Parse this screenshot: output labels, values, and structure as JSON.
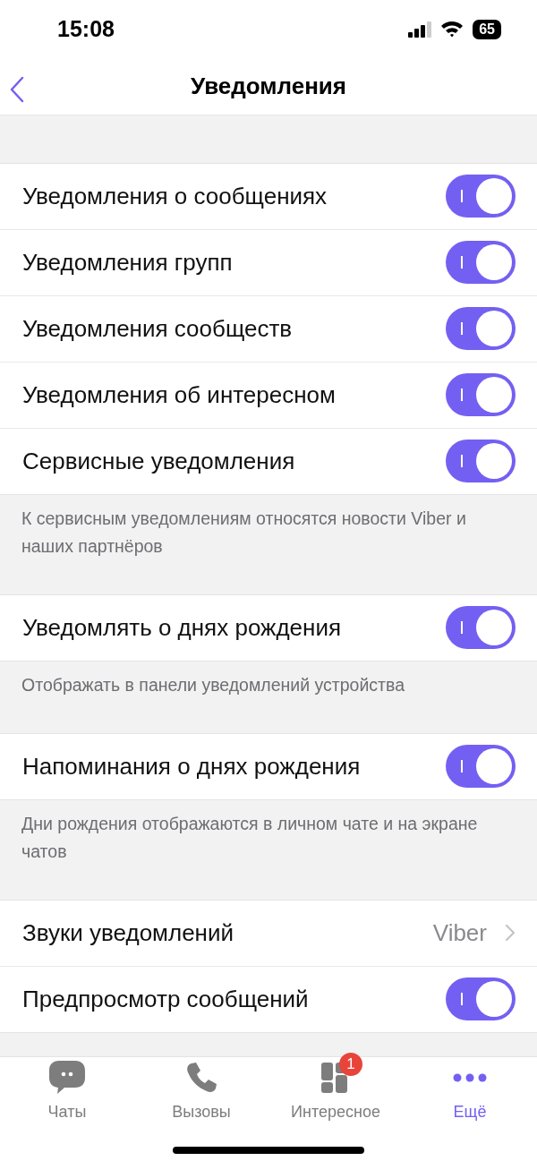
{
  "status_bar": {
    "time": "15:08",
    "battery": "65"
  },
  "nav": {
    "title": "Уведомления"
  },
  "sections": [
    {
      "rows": [
        {
          "kind": "toggle",
          "label": "Уведомления о сообщениях",
          "on": true
        },
        {
          "kind": "toggle",
          "label": "Уведомления групп",
          "on": true
        },
        {
          "kind": "toggle",
          "label": "Уведомления сообществ",
          "on": true
        },
        {
          "kind": "toggle",
          "label": "Уведомления об интересном",
          "on": true
        },
        {
          "kind": "toggle",
          "label": "Сервисные уведомления",
          "on": true
        }
      ],
      "footnote": "К сервисным уведомлениям относятся новости Viber и наших партнёров"
    },
    {
      "rows": [
        {
          "kind": "toggle",
          "label": "Уведомлять о днях рождения",
          "on": true
        }
      ],
      "footnote": "Отображать в панели уведомлений устройства"
    },
    {
      "rows": [
        {
          "kind": "toggle",
          "label": "Напоминания о днях рождения",
          "on": true
        }
      ],
      "footnote": "Дни рождения отображаются в личном чате и на экране чатов"
    },
    {
      "rows": [
        {
          "kind": "value",
          "label": "Звуки уведомлений",
          "value": "Viber"
        },
        {
          "kind": "toggle",
          "label": "Предпросмотр сообщений",
          "on": true
        }
      ]
    }
  ],
  "tab_bar": [
    {
      "kind": "chats",
      "label": "Чаты",
      "selected": false
    },
    {
      "kind": "calls",
      "label": "Вызовы",
      "selected": false
    },
    {
      "kind": "explore",
      "label": "Интересное",
      "selected": false,
      "badge": "1"
    },
    {
      "kind": "more",
      "label": "Ещё",
      "selected": true
    }
  ]
}
